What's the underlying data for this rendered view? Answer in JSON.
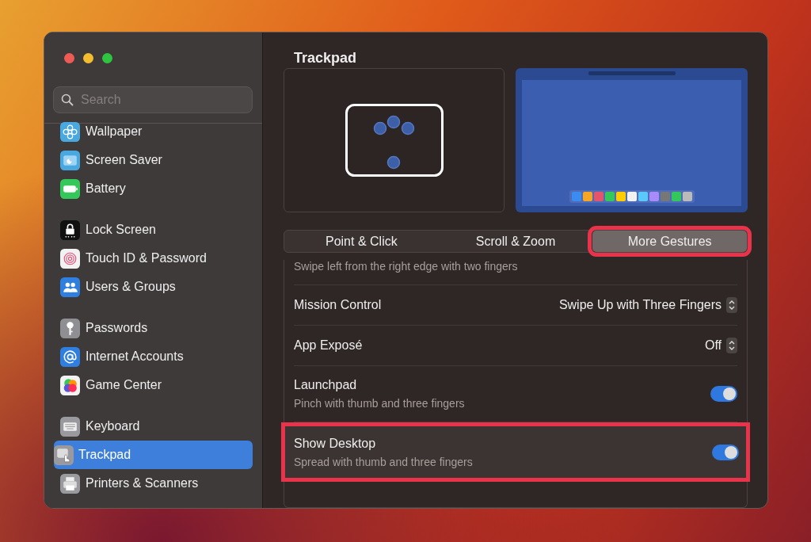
{
  "sidebar": {
    "search": {
      "placeholder": "Search"
    },
    "groups": [
      {
        "items": [
          {
            "label": "Wallpaper",
            "kind": "flower",
            "selected": false
          },
          {
            "label": "Screen Saver",
            "kind": "screen",
            "selected": false
          },
          {
            "label": "Battery",
            "kind": "battery",
            "selected": false
          }
        ]
      },
      {
        "items": [
          {
            "label": "Lock Screen",
            "kind": "lock",
            "selected": false
          },
          {
            "label": "Touch ID & Password",
            "kind": "fingerprint",
            "selected": false
          },
          {
            "label": "Users & Groups",
            "kind": "users",
            "selected": false
          }
        ]
      },
      {
        "items": [
          {
            "label": "Passwords",
            "kind": "key",
            "selected": false
          },
          {
            "label": "Internet Accounts",
            "kind": "at",
            "selected": false
          },
          {
            "label": "Game Center",
            "kind": "bubbles",
            "selected": false
          }
        ]
      },
      {
        "items": [
          {
            "label": "Keyboard",
            "kind": "keyboard",
            "selected": false
          },
          {
            "label": "Trackpad",
            "kind": "trackpad",
            "selected": true
          },
          {
            "label": "Printers & Scanners",
            "kind": "printer",
            "selected": false
          }
        ]
      }
    ]
  },
  "main": {
    "title": "Trackpad",
    "tabs": [
      {
        "label": "Point & Click",
        "selected": false,
        "highlighted": false
      },
      {
        "label": "Scroll & Zoom",
        "selected": false,
        "highlighted": false
      },
      {
        "label": "More Gestures",
        "selected": true,
        "highlighted": true
      }
    ],
    "rows": [
      {
        "kind": "note",
        "subtitle": "Swipe left from the right edge with two fingers",
        "highlighted": false
      },
      {
        "kind": "select",
        "title": "Mission Control",
        "value": "Swipe Up with Three Fingers",
        "highlighted": false
      },
      {
        "kind": "select",
        "title": "App Exposé",
        "value": "Off",
        "highlighted": false
      },
      {
        "kind": "toggle",
        "title": "Launchpad",
        "subtitle": "Pinch with thumb and three fingers",
        "on": true,
        "highlighted": false
      },
      {
        "kind": "toggle",
        "title": "Show Desktop",
        "subtitle": "Spread with thumb and three fingers",
        "on": true,
        "highlighted": true
      }
    ]
  }
}
